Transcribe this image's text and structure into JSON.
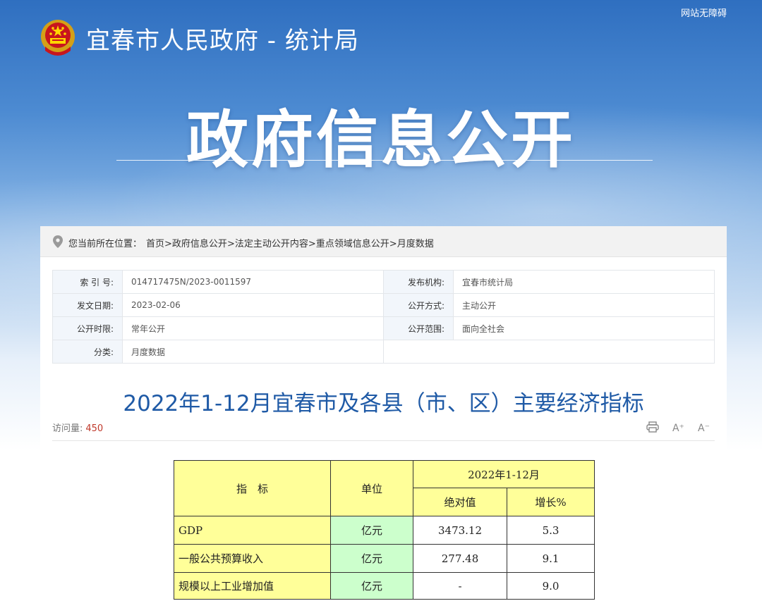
{
  "header": {
    "accessibility_label": "网站无障碍",
    "site_title": "宜春市人民政府 - 统计局",
    "hero_title": "政府信息公开"
  },
  "breadcrumb": {
    "label": "您当前所在位置：",
    "items": [
      "首页",
      "政府信息公开",
      "法定主动公开内容",
      "重点领域信息公开",
      "月度数据"
    ],
    "separator": ">"
  },
  "meta": {
    "index_label": "索 引 号:",
    "index_value": "014717475N/2023-0011597",
    "publisher_label": "发布机构:",
    "publisher_value": "宜春市统计局",
    "date_label": "发文日期:",
    "date_value": "2023-02-06",
    "method_label": "公开方式:",
    "method_value": "主动公开",
    "period_label": "公开时限:",
    "period_value": "常年公开",
    "scope_label": "公开范围:",
    "scope_value": "面向全社会",
    "category_label": "分类:",
    "category_value": "月度数据"
  },
  "article": {
    "title": "2022年1-12月宜春市及各县（市、区）主要经济指标",
    "visits_label": "访问量:",
    "visits_value": "450",
    "font_increase": "A⁺",
    "font_decrease": "A⁻"
  },
  "table": {
    "header_indicator": "指　标",
    "header_unit": "单位",
    "header_period": "2022年1-12月",
    "header_absolute": "绝对值",
    "header_growth": "增长%",
    "rows": [
      {
        "name": "GDP",
        "unit": "亿元",
        "value": "3473.12",
        "growth": "5.3"
      },
      {
        "name": "一般公共预算收入",
        "unit": "亿元",
        "value": "277.48",
        "growth": "9.1"
      },
      {
        "name": "规模以上工业增加值",
        "unit": "亿元",
        "value": "-",
        "growth": "9.0"
      }
    ]
  },
  "colors": {
    "title_blue": "#1f5aa6",
    "table_yellow": "#ffff99",
    "table_green": "#ccffcc",
    "visits_red": "#c0392b"
  }
}
